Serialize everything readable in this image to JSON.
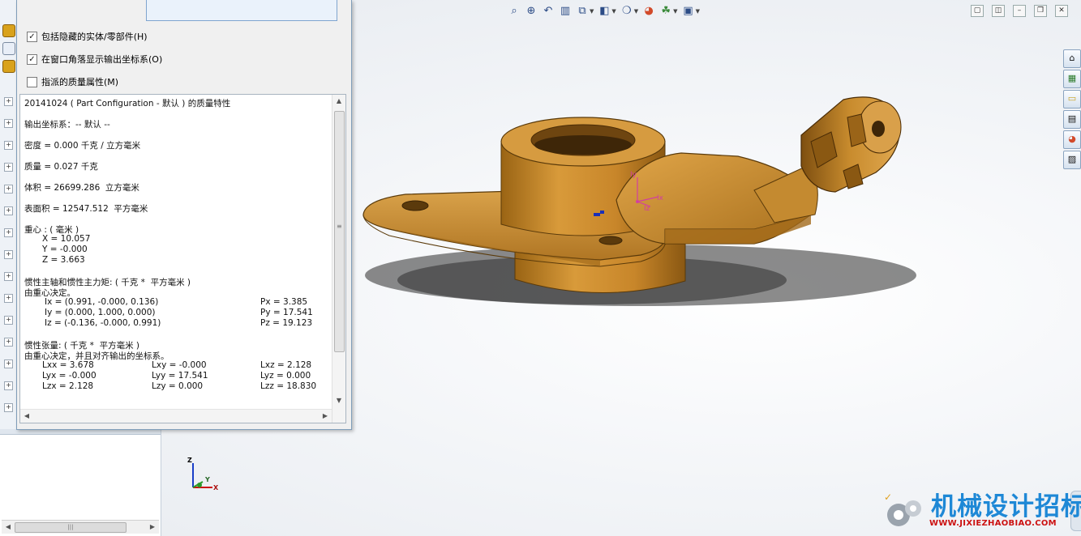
{
  "dialog": {
    "options": [
      {
        "label": "包括隐藏的实体/零部件(H)",
        "checked": true
      },
      {
        "label": "在窗口角落显示输出坐标系(O)",
        "checked": true
      },
      {
        "label": "指派的质量属性(M)",
        "checked": false
      }
    ],
    "results": {
      "title": "20141024 ( Part Configuration - 默认 ) 的质量特性",
      "coord_system": "输出坐标系：-- 默认 --",
      "density": "密度 = 0.000 千克 / 立方毫米",
      "mass": "质量 = 0.027 千克",
      "volume": "体积 = 26699.286  立方毫米",
      "surface_area": "表面积 = 12547.512  平方毫米",
      "cog_header": "重心 : ( 毫米 )",
      "cog_x": "X = 10.057",
      "cog_y": "Y = -0.000",
      "cog_z": "Z = 3.663",
      "principal_header": "惯性主轴和惯性主力矩: ( 千克 *  平方毫米 )",
      "principal_sub": "由重心决定。",
      "ix": "Ix = (0.991, -0.000, 0.136)",
      "iy": "Iy = (0.000, 1.000, 0.000)",
      "iz": "Iz = (-0.136, -0.000, 0.991)",
      "px": "Px = 3.385",
      "py": "Py = 17.541",
      "pz": "Pz = 19.123",
      "tensor_header": "惯性张量: ( 千克 *  平方毫米 )",
      "tensor_sub": "由重心决定，并且对齐输出的坐标系。",
      "lxx": "Lxx = 3.678",
      "lxy": "Lxy = -0.000",
      "lxz": "Lxz = 2.128",
      "lyx": "Lyx = -0.000",
      "lyy": "Lyy = 17.541",
      "lyz": "Lyz = 0.000",
      "lzx": "Lzx = 2.128",
      "lzy": "Lzy = 0.000",
      "lzz": "Lzz = 18.830"
    }
  },
  "view_toolbar": {
    "icons": [
      "zoom-to-fit-icon",
      "zoom-area-icon",
      "previous-view-icon",
      "section-view-icon",
      "view-orientation-icon",
      "display-style-icon",
      "hide-show-items-icon",
      "edit-appearance-icon",
      "apply-scene-icon",
      "view-settings-icon"
    ]
  },
  "task_pane": {
    "icons": [
      "home-icon",
      "design-library-icon",
      "file-explorer-icon",
      "view-palette-icon",
      "appearances-icon",
      "custom-properties-icon"
    ]
  },
  "triad": {
    "x_label": "X",
    "y_label": "Y",
    "z_label": "Z"
  },
  "model_labels": {
    "iy": "Iy",
    "ix": "Ix",
    "iz": "Iz"
  },
  "watermark": {
    "title": "机械设计招标网",
    "url": "WWW.JIXIEZHAOBIAO.COM"
  },
  "colors": {
    "part": "#c8902e",
    "accent": "#1e88d6",
    "url": "#cc1111"
  }
}
